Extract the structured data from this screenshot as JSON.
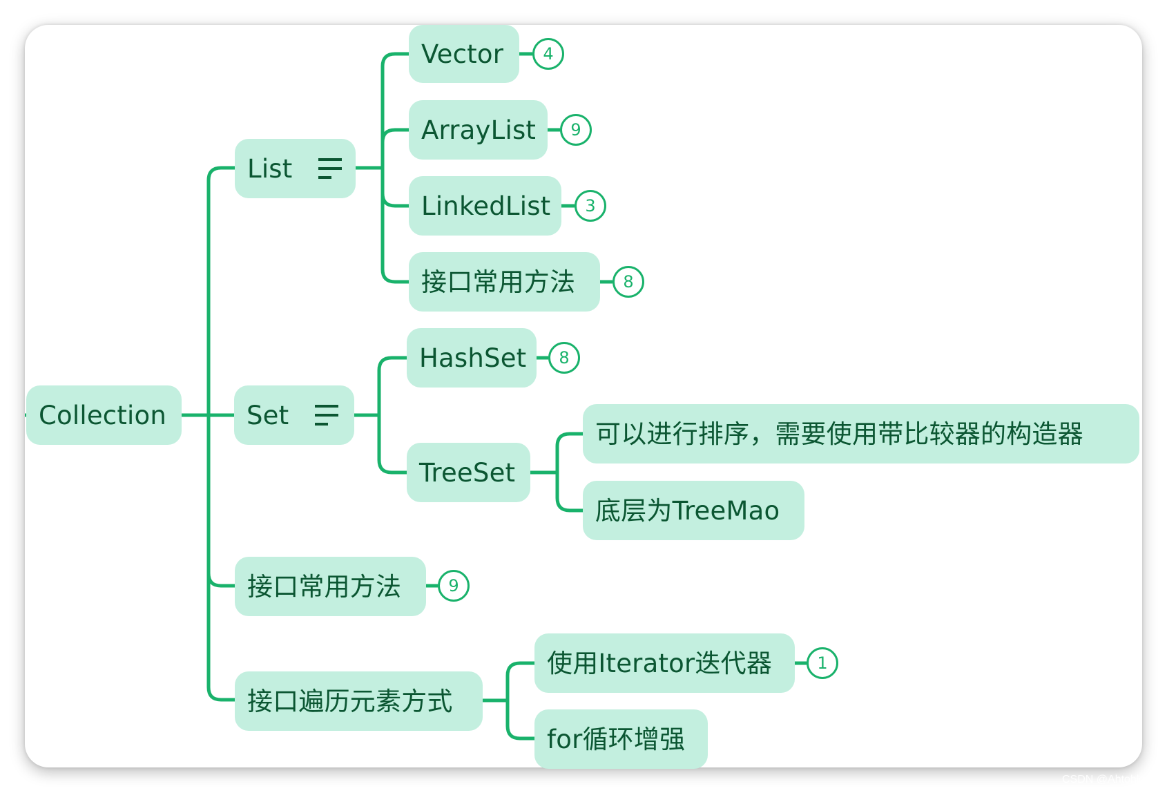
{
  "colors": {
    "line": "#19b26b",
    "node_fill": "#c3efdf",
    "node_text": "#0b5632",
    "badge": "#19b26b"
  },
  "mindmap": {
    "root": {
      "label": "Collection"
    },
    "list": {
      "label": "List",
      "icon": "notes-icon",
      "children": [
        {
          "label": "Vector",
          "badge": "4"
        },
        {
          "label": "ArrayList",
          "badge": "9"
        },
        {
          "label": "LinkedList",
          "badge": "3"
        },
        {
          "label": "接口常用方法",
          "badge": "8"
        }
      ]
    },
    "set": {
      "label": "Set",
      "icon": "notes-icon",
      "children": [
        {
          "label": "HashSet",
          "badge": "8"
        },
        {
          "label": "TreeSet",
          "children": [
            {
              "label": "可以进行排序，需要使用带比较器的构造器"
            },
            {
              "label": "底层为TreeMao"
            }
          ]
        }
      ]
    },
    "methods": {
      "label": "接口常用方法",
      "badge": "9"
    },
    "traverse": {
      "label": "接口遍历元素方式",
      "children": [
        {
          "label": "使用Iterator迭代器",
          "badge": "1"
        },
        {
          "label": "for循环增强"
        }
      ]
    }
  },
  "watermark": "CSDN @Ahtohlove"
}
